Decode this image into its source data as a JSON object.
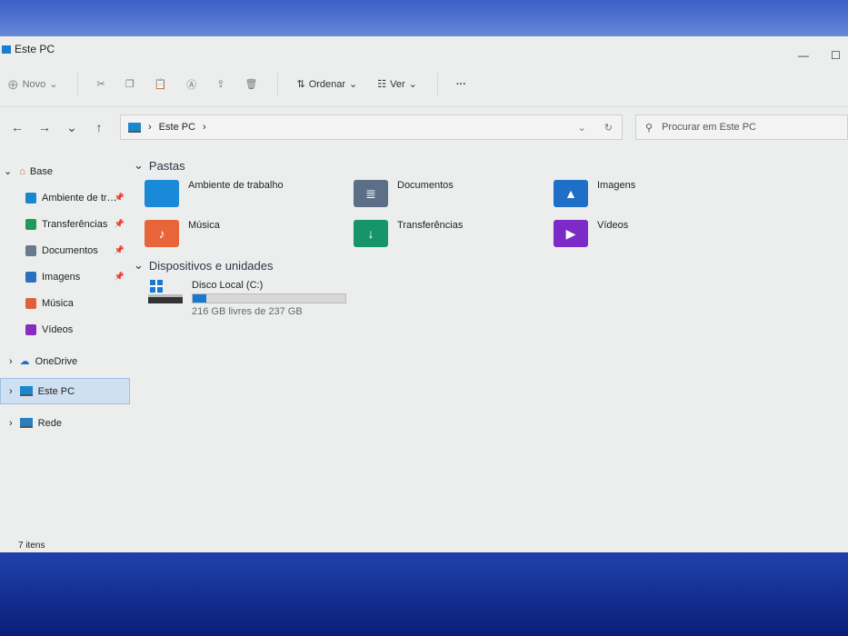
{
  "window": {
    "title": "Este PC",
    "minimize": "—",
    "maximize": "☐"
  },
  "toolbar": {
    "new_label": "Novo",
    "sort_label": "Ordenar",
    "view_label": "Ver",
    "more": "···"
  },
  "nav": {
    "back": "←",
    "forward": "→",
    "recent": "⌄",
    "up": "↑"
  },
  "address": {
    "path": "Este PC",
    "sep": "›",
    "dropdown": "⌄",
    "refresh": "↻"
  },
  "search": {
    "placeholder": "Procurar em Este PC",
    "icon": "⚲"
  },
  "sidebar": {
    "home": "Base",
    "quick": [
      {
        "label": "Ambiente de tr…",
        "color": "#1a86d0"
      },
      {
        "label": "Transferências",
        "color": "#1f9a5a"
      },
      {
        "label": "Documentos",
        "color": "#6a7a8e"
      },
      {
        "label": "Imagens",
        "color": "#2a6fc0"
      },
      {
        "label": "Música",
        "color": "#e0603a"
      },
      {
        "label": "Vídeos",
        "color": "#8a2bc0"
      }
    ],
    "onedrive": "OneDrive",
    "thispc": "Este PC",
    "network": "Rede",
    "pin": "📌"
  },
  "main": {
    "folders_title": "Pastas",
    "folders": [
      {
        "label": "Ambiente de trabalho",
        "color": "#1a8ad8",
        "glyph": ""
      },
      {
        "label": "Documentos",
        "color": "#5c6f86",
        "glyph": "≣"
      },
      {
        "label": "Imagens",
        "color": "#1f6fc8",
        "glyph": "▲"
      },
      {
        "label": "Música",
        "color": "#e8653a",
        "glyph": "♪"
      },
      {
        "label": "Transferências",
        "color": "#16946a",
        "glyph": "↓"
      },
      {
        "label": "Vídeos",
        "color": "#7c2bc8",
        "glyph": "▶"
      }
    ],
    "devices_title": "Dispositivos e unidades",
    "drive": {
      "name": "Disco Local (C:)",
      "free": "216 GB livres de 237 GB",
      "used_fraction": 0.089
    }
  },
  "status": {
    "items": "7 itens"
  }
}
